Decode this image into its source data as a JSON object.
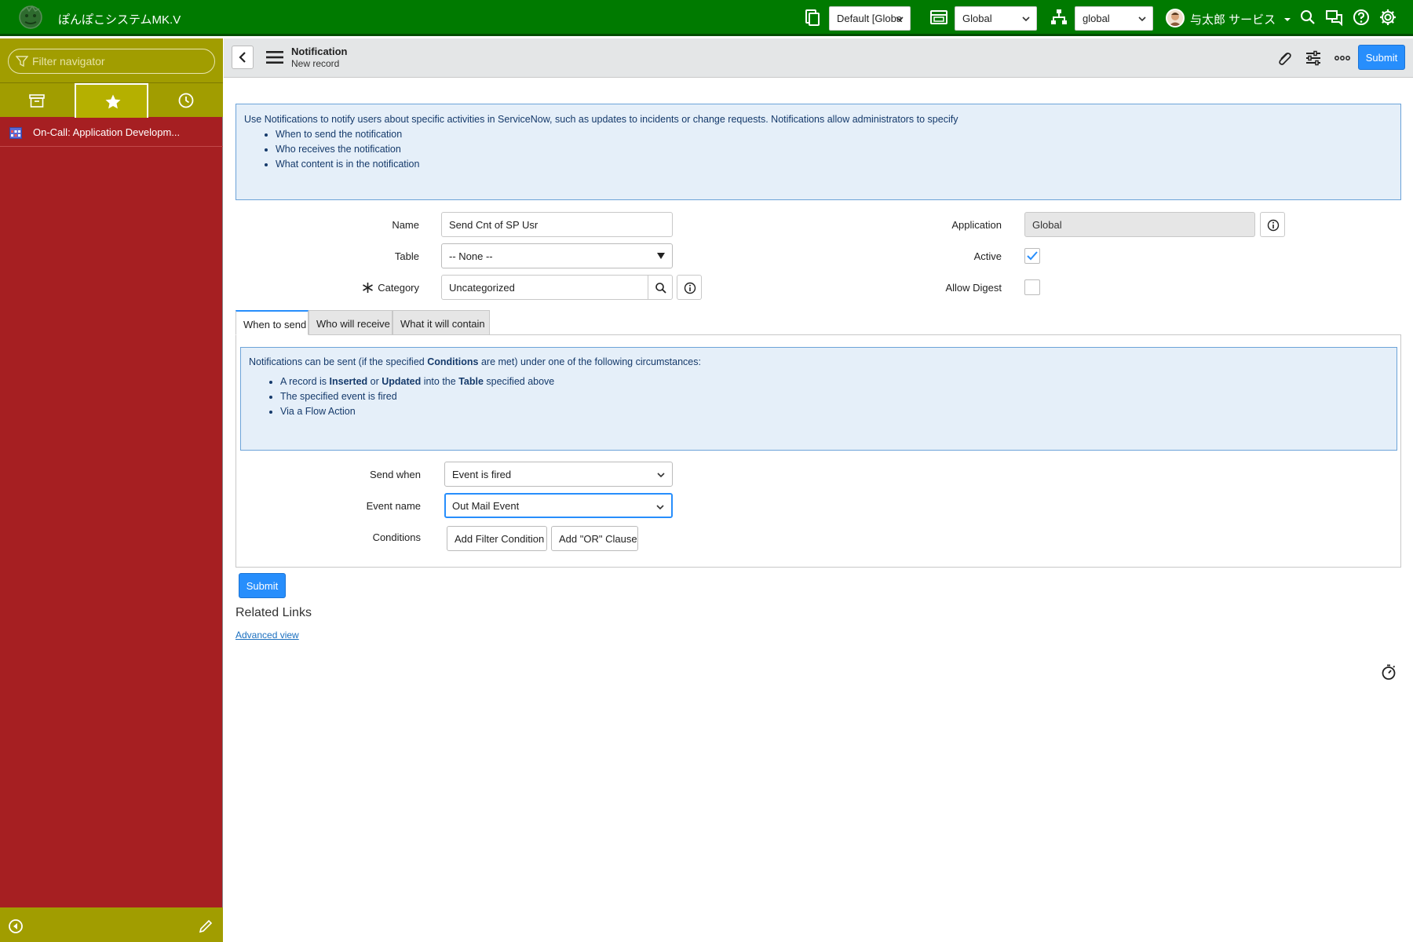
{
  "header": {
    "brand": "ぽんぽこシステムMK.V",
    "update_set": "Default [Globa",
    "app_scope": "Global",
    "domain": "global",
    "user_name": "与太郎 サービス"
  },
  "sidebar": {
    "filter_placeholder": "Filter navigator",
    "favorites": [
      {
        "label": "On-Call: Application Developm..."
      }
    ]
  },
  "form_header": {
    "title": "Notification",
    "subtitle": "New record",
    "submit_label": "Submit"
  },
  "intro": {
    "text": "Use Notifications to notify users about specific activities in ServiceNow, such as updates to incidents or change requests. Notifications allow administrators to specify",
    "bullets": [
      "When to send the notification",
      "Who receives the notification",
      "What content is in the notification"
    ]
  },
  "fields": {
    "name_label": "Name",
    "name_value": "Send Cnt of SP Usr",
    "table_label": "Table",
    "table_value": "-- None --",
    "category_label": "Category",
    "category_value": "Uncategorized",
    "application_label": "Application",
    "application_value": "Global",
    "active_label": "Active",
    "active_checked": true,
    "allow_digest_label": "Allow Digest",
    "allow_digest_checked": false
  },
  "tabs": [
    {
      "label": "When to send",
      "active": true
    },
    {
      "label": "Who will receive",
      "active": false
    },
    {
      "label": "What it will contain",
      "active": false
    }
  ],
  "when_to_send": {
    "intro_pre": "Notifications can be sent (if the specified ",
    "intro_bold": "Conditions",
    "intro_post": " are met) under one of the following circumstances:",
    "bullet1_a": "A record is ",
    "bullet1_b": "Inserted",
    "bullet1_c": " or ",
    "bullet1_d": "Updated",
    "bullet1_e": " into the ",
    "bullet1_f": "Table",
    "bullet1_g": " specified above",
    "bullet2": "The specified event is fired",
    "bullet3": "Via a Flow Action",
    "send_when_label": "Send when",
    "send_when_value": "Event is fired",
    "event_name_label": "Event name",
    "event_name_value": "Out Mail Event",
    "conditions_label": "Conditions",
    "add_filter_label": "Add Filter Condition",
    "add_or_label": "Add \"OR\" Clause"
  },
  "footer": {
    "submit_label": "Submit",
    "related_links_title": "Related Links",
    "advanced_view": "Advanced view"
  },
  "colors": {
    "header_bg": "#007a00",
    "sidebar_bg": "#a61f22",
    "sidebar_accent": "#a19d00",
    "primary_button": "#278efc",
    "info_bg": "#e5eff9"
  }
}
